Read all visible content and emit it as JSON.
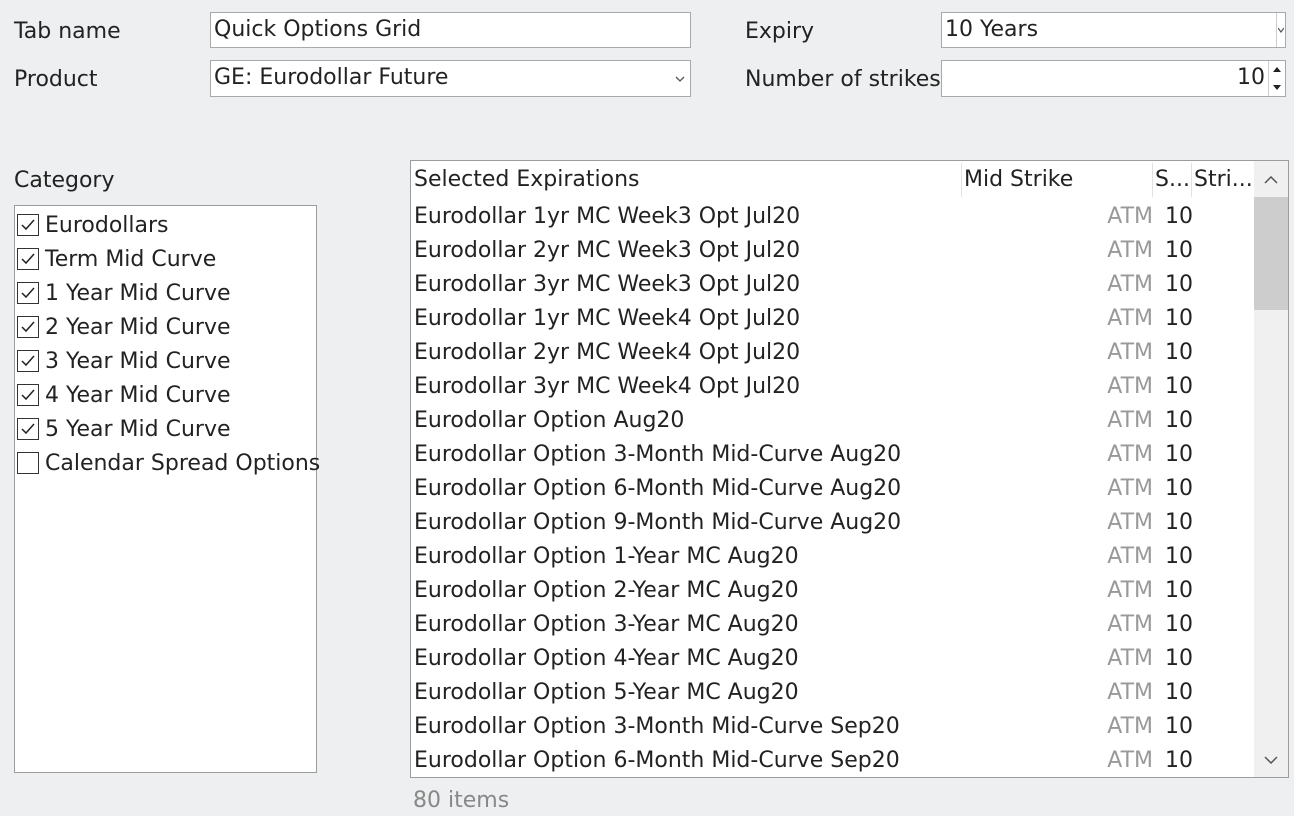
{
  "form": {
    "tab_name_label": "Tab name",
    "tab_name_value": "Quick Options Grid",
    "product_label": "Product",
    "product_value": "GE: Eurodollar Future",
    "expiry_label": "Expiry",
    "expiry_value": "10  Years",
    "strikes_label": "Number of strikes",
    "strikes_value": "10"
  },
  "category": {
    "label": "Category",
    "items": [
      {
        "label": "Eurodollars",
        "checked": true
      },
      {
        "label": "Term Mid Curve",
        "checked": true
      },
      {
        "label": "1 Year Mid Curve",
        "checked": true
      },
      {
        "label": "2 Year Mid Curve",
        "checked": true
      },
      {
        "label": "3 Year Mid Curve",
        "checked": true
      },
      {
        "label": "4 Year Mid Curve",
        "checked": true
      },
      {
        "label": "5 Year Mid Curve",
        "checked": true
      },
      {
        "label": "Calendar Spread Options",
        "checked": false
      }
    ]
  },
  "grid": {
    "columns": [
      "Selected Expirations",
      "Mid Strike",
      "S...",
      "Stri..."
    ],
    "rows": [
      {
        "name": "Eurodollar 1yr MC Week3 Opt Jul20",
        "mid": "ATM",
        "strikes": "10"
      },
      {
        "name": "Eurodollar 2yr MC Week3 Opt Jul20",
        "mid": "ATM",
        "strikes": "10"
      },
      {
        "name": "Eurodollar 3yr MC Week3 Opt Jul20",
        "mid": "ATM",
        "strikes": "10"
      },
      {
        "name": "Eurodollar 1yr MC Week4 Opt Jul20",
        "mid": "ATM",
        "strikes": "10"
      },
      {
        "name": "Eurodollar 2yr MC Week4 Opt Jul20",
        "mid": "ATM",
        "strikes": "10"
      },
      {
        "name": "Eurodollar 3yr MC Week4 Opt Jul20",
        "mid": "ATM",
        "strikes": "10"
      },
      {
        "name": "Eurodollar Option Aug20",
        "mid": "ATM",
        "strikes": "10"
      },
      {
        "name": "Eurodollar Option 3-Month Mid-Curve Aug20",
        "mid": "ATM",
        "strikes": "10"
      },
      {
        "name": "Eurodollar Option 6-Month Mid-Curve Aug20",
        "mid": "ATM",
        "strikes": "10"
      },
      {
        "name": "Eurodollar Option 9-Month Mid-Curve Aug20",
        "mid": "ATM",
        "strikes": "10"
      },
      {
        "name": "Eurodollar Option 1-Year MC Aug20",
        "mid": "ATM",
        "strikes": "10"
      },
      {
        "name": "Eurodollar Option 2-Year MC Aug20",
        "mid": "ATM",
        "strikes": "10"
      },
      {
        "name": "Eurodollar Option 3-Year MC Aug20",
        "mid": "ATM",
        "strikes": "10"
      },
      {
        "name": "Eurodollar Option 4-Year MC Aug20",
        "mid": "ATM",
        "strikes": "10"
      },
      {
        "name": "Eurodollar Option 5-Year MC Aug20",
        "mid": "ATM",
        "strikes": "10"
      },
      {
        "name": "Eurodollar Option 3-Month Mid-Curve Sep20",
        "mid": "ATM",
        "strikes": "10"
      },
      {
        "name": "Eurodollar Option 6-Month Mid-Curve Sep20",
        "mid": "ATM",
        "strikes": "10"
      }
    ],
    "item_count": "80 items"
  },
  "icons": {
    "combo_arrow": "chevron-down-icon",
    "spin_up": "spin-up-icon",
    "spin_down": "spin-down-icon",
    "checkmark": "checkmark-icon",
    "scroll_up": "scroll-up-icon",
    "scroll_down": "scroll-down-icon"
  },
  "colors": {
    "window_bg": "#eeeff0",
    "muted_text": "#999999"
  }
}
